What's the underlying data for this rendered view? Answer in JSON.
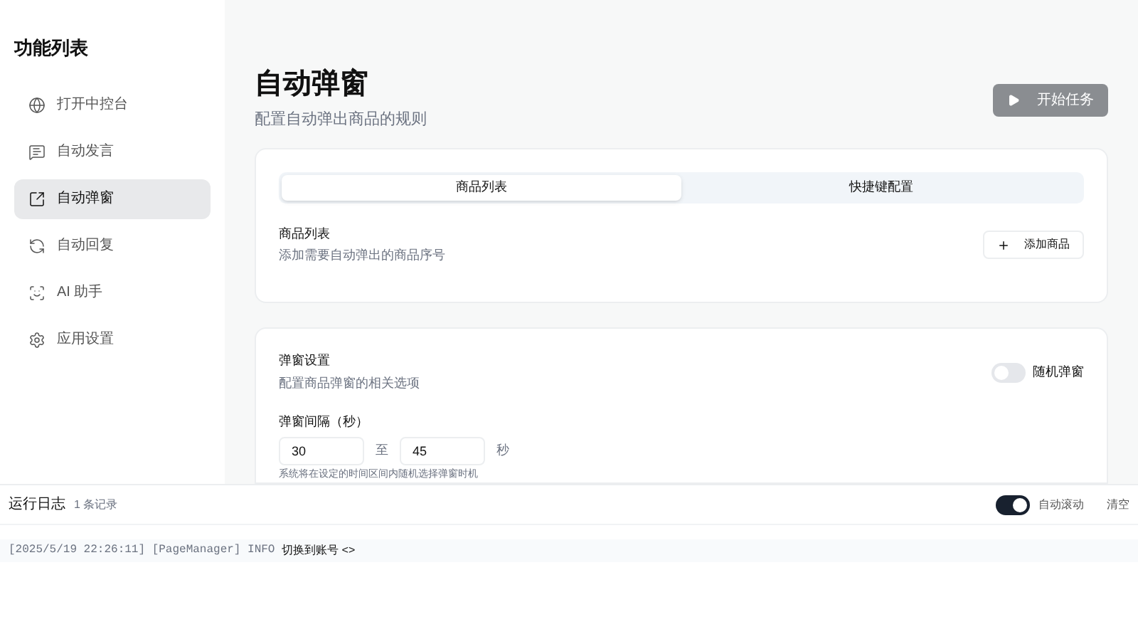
{
  "sidebar": {
    "title": "功能列表",
    "items": [
      {
        "label": "打开中控台",
        "selected": false
      },
      {
        "label": "自动发言",
        "selected": false
      },
      {
        "label": "自动弹窗",
        "selected": true
      },
      {
        "label": "自动回复",
        "selected": false
      },
      {
        "label": "AI 助手",
        "selected": false
      },
      {
        "label": "应用设置",
        "selected": false
      }
    ]
  },
  "header": {
    "title": "自动弹窗",
    "subtitle": "配置自动弹出商品的规则",
    "start_button": "开始任务",
    "start_disabled": true
  },
  "products_card": {
    "tabs": [
      {
        "label": "商品列表",
        "selected": true
      },
      {
        "label": "快捷键配置",
        "selected": false
      }
    ],
    "section_title": "商品列表",
    "section_desc": "添加需要自动弹出的商品序号",
    "add_button": "添加商品"
  },
  "popup_card": {
    "title": "弹窗设置",
    "desc": "配置商品弹窗的相关选项",
    "random_toggle": {
      "label": "随机弹窗",
      "on": false
    },
    "interval_label": "弹窗间隔（秒）",
    "min": "30",
    "to": "至",
    "max": "45",
    "unit": "秒",
    "hint": "系统将在设定的时间区间内随机选择弹窗时机"
  },
  "log": {
    "title": "运行日志",
    "count": "1 条记录",
    "auto_scroll": {
      "label": "自动滚动",
      "on": true
    },
    "clear_button": "清空",
    "entries": [
      {
        "prefix": "[2025/5/19 22:26:11] [PageManager] INFO",
        "message": "切换到账号 <>"
      }
    ]
  }
}
